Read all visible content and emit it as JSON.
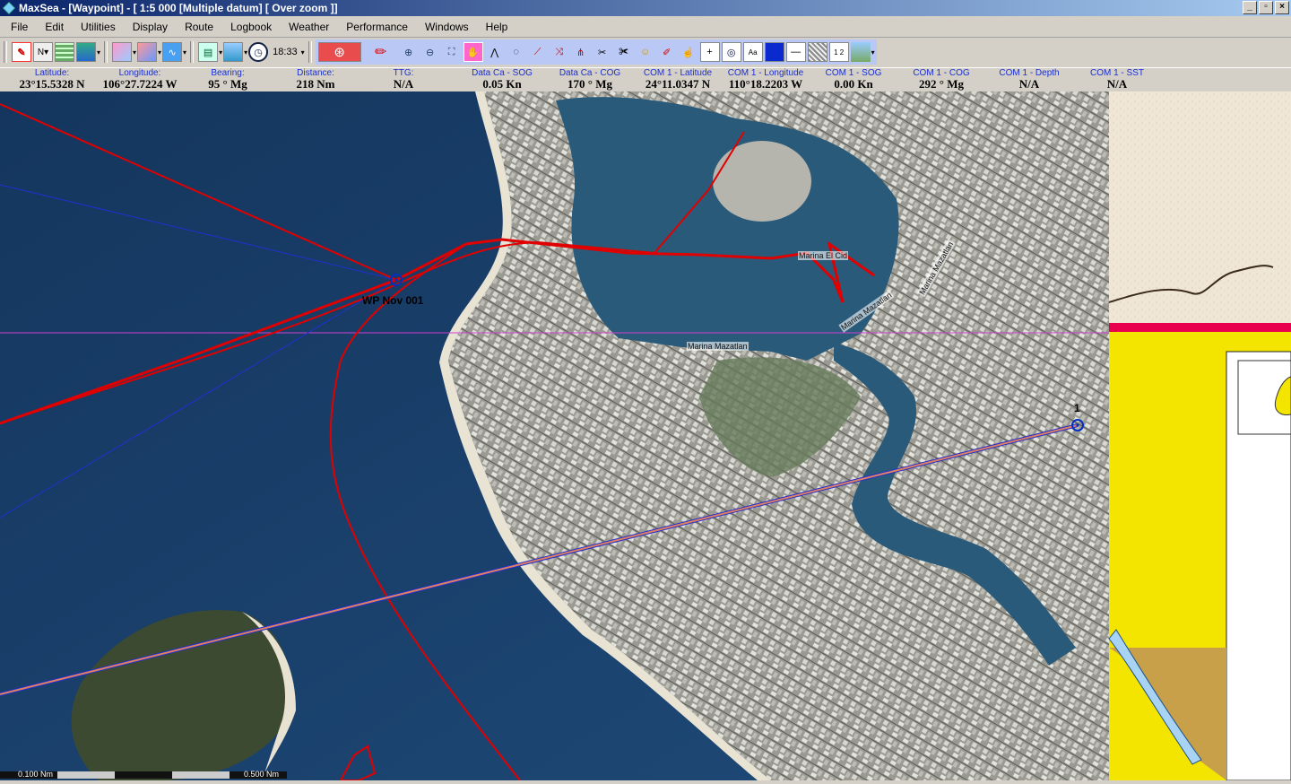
{
  "window": {
    "title": "MaxSea - [Waypoint] - [ 1:5 000 [Multiple datum]  [ Over zoom ]]"
  },
  "menu": [
    "File",
    "Edit",
    "Utilities",
    "Display",
    "Route",
    "Logbook",
    "Weather",
    "Performance",
    "Windows",
    "Help"
  ],
  "toolbar": {
    "time": "18:33"
  },
  "databar": [
    {
      "label": "Latitude:",
      "value": "23°15.5328 N"
    },
    {
      "label": "Longitude:",
      "value": "106°27.7224 W"
    },
    {
      "label": "Bearing:",
      "value": "95 ° Mg"
    },
    {
      "label": "Distance:",
      "value": "218 Nm"
    },
    {
      "label": "TTG:",
      "value": "N/A"
    },
    {
      "label": "Data Ca - SOG",
      "value": "0.05 Kn"
    },
    {
      "label": "Data Ca - COG",
      "value": "170 ° Mg"
    },
    {
      "label": "COM 1 - Latitude",
      "value": "24°11.0347 N"
    },
    {
      "label": "COM 1 - Longitude",
      "value": "110°18.2203 W"
    },
    {
      "label": "COM 1 - SOG",
      "value": "0.00 Kn"
    },
    {
      "label": "COM 1 - COG",
      "value": "292 ° Mg"
    },
    {
      "label": "COM 1 - Depth",
      "value": "N/A"
    },
    {
      "label": "COM 1 - SST",
      "value": "N/A"
    }
  ],
  "map": {
    "waypoint_label": "WP Nov 001",
    "waypoint2_label": "1",
    "streets": {
      "marina1": "Marina Mazatlan",
      "marina2": "Marina Mazatlan",
      "marina3": "Marina Mazatlan",
      "marina_elcid": "Marina El Cid"
    },
    "scale": {
      "left": "0.100 Nm",
      "right": "0.500 Nm"
    }
  },
  "colors": {
    "track": "#e00000",
    "route": "#2030d0",
    "crosshair": "#d040d0",
    "land": "#f4e500",
    "sea": "#1a3b63"
  }
}
